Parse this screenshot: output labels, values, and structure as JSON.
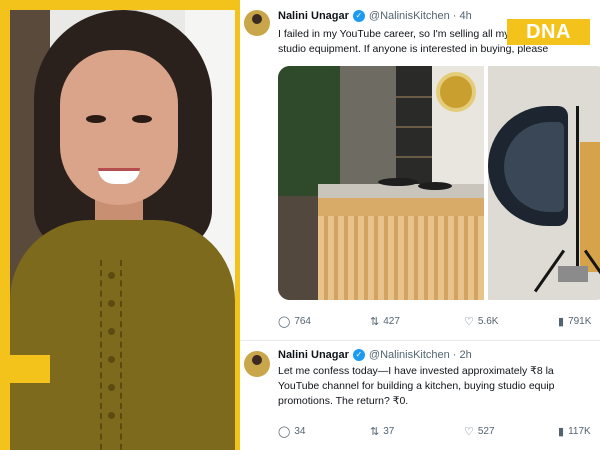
{
  "brand": {
    "logo_text": "DNA",
    "accent": "#f3c31b"
  },
  "tweets": [
    {
      "name": "Nalini Unagar",
      "handle": "@NalinisKitchen",
      "separator": "·",
      "time": "4h",
      "text_lines": [
        "I failed in my YouTube career, so I'm selling all my kitchen a",
        "studio equipment. If anyone is interested in buying, please"
      ],
      "stats": {
        "replies": "764",
        "reposts": "427",
        "likes": "5.6K",
        "views": "791K"
      }
    },
    {
      "name": "Nalini Unagar",
      "handle": "@NalinisKitchen",
      "separator": "·",
      "time": "2h",
      "text_lines": [
        "Let me confess today—I have invested approximately ₹8 la",
        "YouTube channel for building a kitchen, buying studio equip",
        "promotions. The return? ₹0."
      ],
      "stats": {
        "replies": "34",
        "reposts": "37",
        "likes": "527",
        "views": "117K"
      }
    }
  ],
  "icons": {
    "reply": "reply-icon",
    "repost": "repost-icon",
    "like": "heart-icon",
    "views": "views-icon",
    "verified": "verified-badge-icon"
  },
  "colors": {
    "verified": "#1d9bf0",
    "muted_text": "#536471",
    "text": "#0f1419"
  }
}
